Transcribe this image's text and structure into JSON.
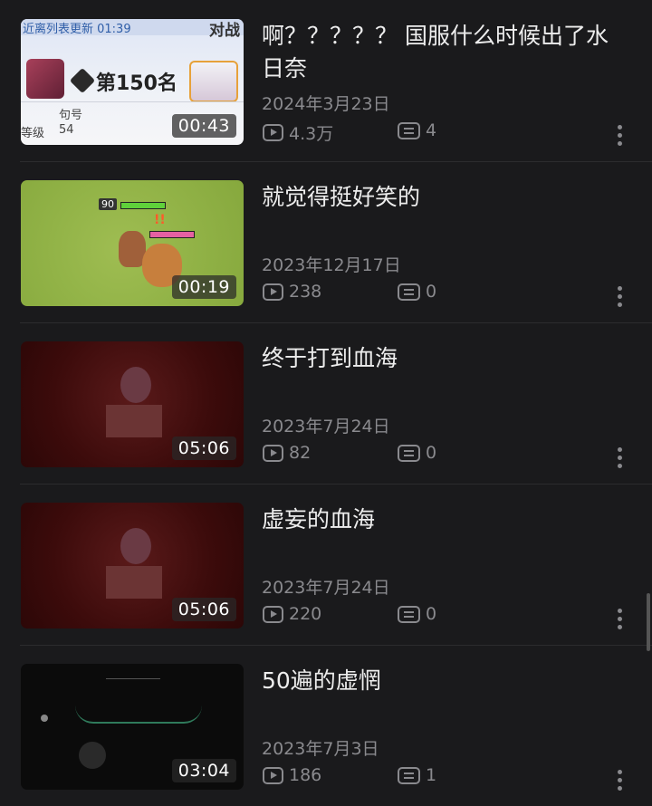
{
  "videos": [
    {
      "title": "啊？？？？？ 国服什么时候出了水日奈",
      "date": "2024年3月23日",
      "views": "4.3万",
      "comments": "4",
      "duration": "00:43",
      "thumb_text": {
        "top_left": "近离列表更新 01:39",
        "top_right": "对战",
        "rank": "第150名",
        "label_a": "句号",
        "label_b": "等级",
        "value_b": "54"
      }
    },
    {
      "title": "就觉得挺好笑的",
      "date": "2023年12月17日",
      "views": "238",
      "comments": "0",
      "duration": "00:19",
      "thumb_text": {
        "level": "90"
      }
    },
    {
      "title": "终于打到血海",
      "date": "2023年7月24日",
      "views": "82",
      "comments": "0",
      "duration": "05:06"
    },
    {
      "title": "虚妄的血海",
      "date": "2023年7月24日",
      "views": "220",
      "comments": "0",
      "duration": "05:06"
    },
    {
      "title": "50遍的虚惘",
      "date": "2023年7月3日",
      "views": "186",
      "comments": "1",
      "duration": "03:04"
    }
  ]
}
